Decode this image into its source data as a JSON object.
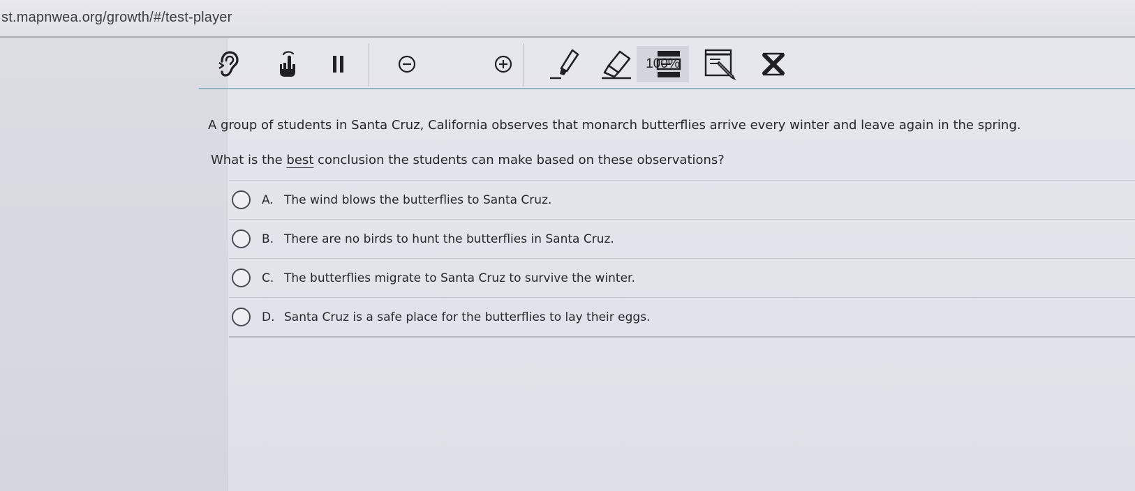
{
  "browser": {
    "url": "st.mapnwea.org/growth/#/test-player"
  },
  "toolbar": {
    "tools": [
      {
        "icon": "listen-ear-icon"
      },
      {
        "icon": "raise-hand-icon"
      },
      {
        "icon": "pause-icon"
      },
      {
        "icon": "zoom-out-icon"
      },
      {
        "icon": "zoom-in-icon"
      },
      {
        "icon": "highlighter-icon"
      },
      {
        "icon": "eraser-icon"
      },
      {
        "icon": "line-reader-icon"
      },
      {
        "icon": "notepad-icon"
      },
      {
        "icon": "answer-eliminator-icon"
      }
    ],
    "zoom_level": "100%"
  },
  "question": {
    "stem": "A group of students in Santa Cruz, California observes that monarch butterflies arrive every winter and leave again in the spring.",
    "prompt_before": "What is the ",
    "prompt_emphasis": "best",
    "prompt_after": " conclusion the students can make based on these observations?"
  },
  "choices": [
    {
      "letter": "A.",
      "text": "The wind blows the butterflies to Santa Cruz.",
      "selected": false
    },
    {
      "letter": "B.",
      "text": "There are no birds to hunt the butterflies in Santa Cruz.",
      "selected": false
    },
    {
      "letter": "C.",
      "text": "The butterflies migrate to Santa Cruz to survive the winter.",
      "selected": false
    },
    {
      "letter": "D.",
      "text": "Santa Cruz is a safe place for the butterflies to lay their eggs.",
      "selected": false
    }
  ]
}
